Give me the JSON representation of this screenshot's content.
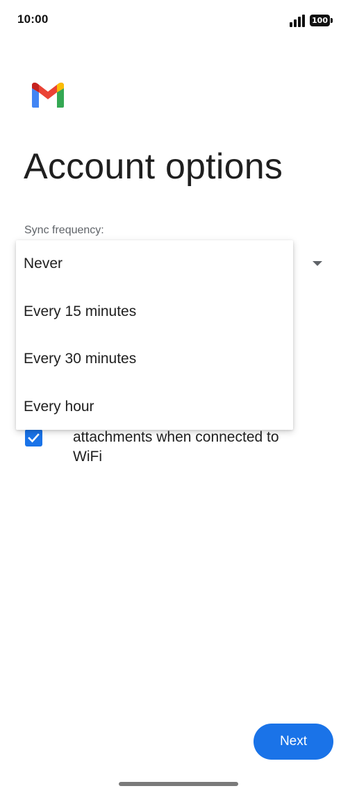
{
  "status_bar": {
    "time": "10:00",
    "battery": "100"
  },
  "icons": {
    "logo": "gmail-logo-icon",
    "signal": "signal-icon",
    "battery": "battery-icon",
    "dropdown": "triangle-down-icon",
    "checkbox": "checkmark-icon"
  },
  "colors": {
    "accent": "#1a73e8",
    "gmail_red": "#ea4335",
    "gmail_blue": "#4285f4",
    "gmail_green": "#34a853",
    "gmail_yellow": "#fbbc04",
    "dark_red": "#c5221f"
  },
  "page": {
    "title": "Account options",
    "sync_label": "Sync frequency:"
  },
  "dropdown": {
    "options": [
      "Never",
      "Every 15 minutes",
      "Every 30 minutes",
      "Every hour"
    ]
  },
  "checkbox": {
    "checked": true,
    "label_line1": "attachments when connected to",
    "label_line2": "WiFi"
  },
  "actions": {
    "next_label": "Next"
  }
}
